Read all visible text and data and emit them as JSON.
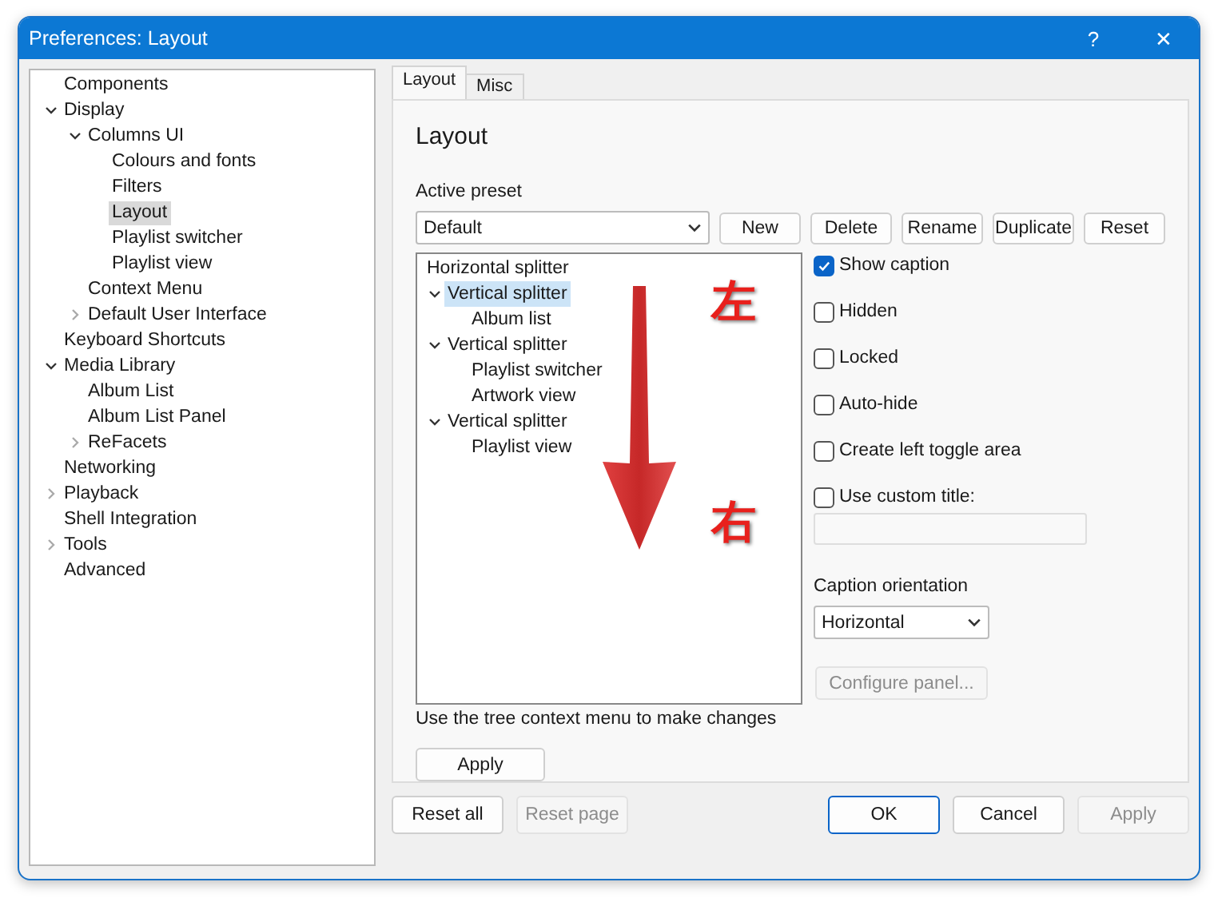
{
  "window": {
    "title": "Preferences: Layout",
    "controls": [
      "?",
      "✕"
    ]
  },
  "sidebar": {
    "items": [
      {
        "label": "Components",
        "selected": false
      },
      {
        "label": "Display",
        "selected": false,
        "expanded": true,
        "children": [
          {
            "label": "Columns UI",
            "selected": false,
            "expanded": true,
            "children": [
              {
                "label": "Colours and fonts",
                "selected": false
              },
              {
                "label": "Filters",
                "selected": false
              },
              {
                "label": "Layout",
                "selected": true
              },
              {
                "label": "Playlist switcher",
                "selected": false
              },
              {
                "label": "Playlist view",
                "selected": false
              }
            ]
          },
          {
            "label": "Context Menu",
            "selected": false
          },
          {
            "label": "Default User Interface",
            "selected": false,
            "expanded": false
          }
        ]
      },
      {
        "label": "Keyboard Shortcuts",
        "selected": false
      },
      {
        "label": "Media Library",
        "selected": false,
        "expanded": true,
        "children": [
          {
            "label": "Album List",
            "selected": false
          },
          {
            "label": "Album List Panel",
            "selected": false
          },
          {
            "label": "ReFacets",
            "selected": false,
            "expanded": false
          }
        ]
      },
      {
        "label": "Networking",
        "selected": false
      },
      {
        "label": "Playback",
        "selected": false,
        "expanded": false
      },
      {
        "label": "Shell Integration",
        "selected": false
      },
      {
        "label": "Tools",
        "selected": false,
        "expanded": false
      },
      {
        "label": "Advanced",
        "selected": false
      }
    ]
  },
  "tabs": [
    {
      "label": "Layout",
      "selected": true
    },
    {
      "label": "Misc",
      "selected": false
    }
  ],
  "page": {
    "heading": "Layout",
    "preset_label": "Active preset",
    "preset_value": "Default",
    "preset_buttons": [
      "New",
      "Delete",
      "Rename",
      "Duplicate",
      "Reset"
    ],
    "layout_tree": {
      "label": "Horizontal splitter",
      "children": [
        {
          "label": "Vertical splitter",
          "expanded": true,
          "selected": true,
          "children": [
            {
              "label": "Album list",
              "selected": false
            }
          ]
        },
        {
          "label": "Vertical splitter",
          "expanded": true,
          "selected": false,
          "children": [
            {
              "label": "Playlist switcher",
              "selected": false
            },
            {
              "label": "Artwork view",
              "selected": false
            }
          ]
        },
        {
          "label": "Vertical splitter",
          "expanded": true,
          "selected": false,
          "children": [
            {
              "label": "Playlist view",
              "selected": false
            }
          ]
        }
      ]
    },
    "annotations": [
      "左",
      "右"
    ],
    "options": [
      {
        "kind": "checkbox",
        "label": "Show caption",
        "checked": true
      },
      {
        "kind": "checkbox",
        "label": "Hidden",
        "checked": false
      },
      {
        "kind": "checkbox",
        "label": "Locked",
        "checked": false
      },
      {
        "kind": "checkbox",
        "label": "Auto-hide",
        "checked": false
      },
      {
        "kind": "checkbox",
        "label": "Create left toggle area",
        "checked": false
      },
      {
        "kind": "checkbox_field",
        "label": "Use custom title:",
        "checked": false
      }
    ],
    "orientation_label": "Caption orientation",
    "orientation_value": "Horizontal",
    "configure_button": {
      "label": "Configure panel...",
      "disabled": true
    },
    "hint": "Use the tree context menu to make changes",
    "apply_button": "Apply"
  },
  "footer": {
    "left_buttons": [
      {
        "label": "Reset all",
        "disabled": false
      },
      {
        "label": "Reset page",
        "disabled": true
      }
    ],
    "right_buttons": [
      {
        "label": "OK",
        "disabled": false,
        "default": true
      },
      {
        "label": "Cancel",
        "disabled": false,
        "default": false
      },
      {
        "label": "Apply",
        "disabled": true,
        "default": false
      }
    ]
  }
}
